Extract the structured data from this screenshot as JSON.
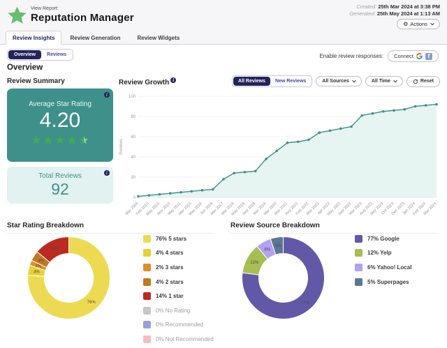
{
  "header": {
    "view_report_label": "View Report:",
    "title": "Reputation Manager",
    "created_label": "Created:",
    "created_value": "25th Mar 2024 at 3:38 PM",
    "generated_label": "Generated:",
    "generated_value": "25th May 2024 at 1:13 AM",
    "actions_label": "Actions"
  },
  "icons": {
    "gear": "⚙",
    "info": "i",
    "facebook": "f"
  },
  "tabs": [
    {
      "label": "Review Insights",
      "active": true
    },
    {
      "label": "Review Generation",
      "active": false
    },
    {
      "label": "Review Widgets",
      "active": false
    }
  ],
  "toolbar": {
    "overview_label": "Overview",
    "reviews_label": "Reviews",
    "enable_reviews_label": "Enable review responses:",
    "connect_label": "Connect"
  },
  "overview": {
    "heading": "Overview"
  },
  "review_summary": {
    "section_title": "Review Summary",
    "average_label": "Average Star Rating",
    "average_value": "4.20",
    "stars_display": 4.5,
    "star_color": "#3fae4c",
    "star_empty_color": "#85cf9f",
    "total_label": "Total Reviews",
    "total_value": "92"
  },
  "review_growth": {
    "section_title": "Review Growth",
    "all_reviews_label": "All Reviews",
    "new_reviews_label": "New Reviews",
    "all_sources_label": "All Sources",
    "all_time_label": "All Time",
    "reset_label": "Reset"
  },
  "sections": {
    "star_breakdown_title": "Star Rating Breakdown",
    "source_breakdown_title": "Review Source Breakdown"
  },
  "chart_data": [
    {
      "type": "line",
      "title": "Review Growth",
      "ylabel": "Reviews",
      "ylim": [
        0,
        100
      ],
      "yticks": [
        0,
        20,
        40,
        60,
        80,
        100
      ],
      "grid": true,
      "line_color": "#3a9188",
      "fill_color": "#e6f4f2",
      "x": [
        "Mar 2009",
        "Feb 2010",
        "May 2010",
        "Nov 2010",
        "May 2011",
        "Mar 2015",
        "May 2016",
        "Jun 2016",
        "Mar 2017",
        "Mar 2018",
        "May 2018",
        "Sep 2018",
        "Mar 2019",
        "Mar 2020",
        "Mar 2021",
        "Aug 2021",
        "Feb 2022",
        "Mar 2022",
        "Apr 2022",
        "May 2022",
        "Sep 2022",
        "Mar 2023",
        "Aug 2023",
        "Sep 2023",
        "Oct 2023",
        "Dec 2023",
        "Jan 2024",
        "Feb 2024",
        "Mar 2024"
      ],
      "values": [
        1,
        2,
        3,
        4,
        5,
        6,
        7,
        8,
        18,
        24,
        25,
        26,
        38,
        46,
        54,
        55,
        57,
        64,
        66,
        68,
        70,
        81,
        83,
        85,
        86,
        87,
        90,
        91,
        92
      ]
    },
    {
      "type": "pie",
      "title": "Star Rating Breakdown",
      "legend_position": "right",
      "slices": [
        {
          "label": "5 stars",
          "pct": 76,
          "color": "#ecdb52"
        },
        {
          "label": "4 stars",
          "pct": 4,
          "color": "#e6d138"
        },
        {
          "label": "3 stars",
          "pct": 2,
          "color": "#df8d28"
        },
        {
          "label": "2 stars",
          "pct": 4,
          "color": "#c27a22"
        },
        {
          "label": "1 star",
          "pct": 14,
          "color": "#bc2a1f"
        },
        {
          "label": "No Rating",
          "pct": 0,
          "color": "#c6c6c6"
        },
        {
          "label": "Recommended",
          "pct": 0,
          "color": "#9c9ed9"
        },
        {
          "label": "Not Recommended",
          "pct": 0,
          "color": "#f3bdc1"
        }
      ]
    },
    {
      "type": "pie",
      "title": "Review Source Breakdown",
      "legend_position": "right",
      "slices": [
        {
          "label": "Google",
          "pct": 77,
          "color": "#6159a8"
        },
        {
          "label": "Yelp",
          "pct": 12,
          "color": "#a7be52"
        },
        {
          "label": "Yahoo! Local",
          "pct": 6,
          "color": "#b2a0f2"
        },
        {
          "label": "Superpages",
          "pct": 5,
          "color": "#5a7795"
        }
      ]
    }
  ]
}
